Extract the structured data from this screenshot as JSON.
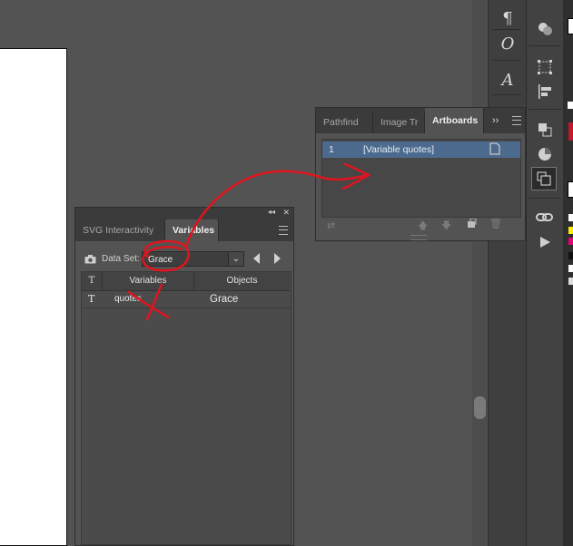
{
  "artboards_panel": {
    "tabs": [
      {
        "label": "Pathfind"
      },
      {
        "label": "Image Tr"
      },
      {
        "label": "Artboards"
      }
    ],
    "overflow_label": "››",
    "rows": [
      {
        "number": "1",
        "name": "[Variable quotes]"
      }
    ]
  },
  "variables_panel": {
    "tabs": [
      {
        "label": "SVG Interactivity"
      },
      {
        "label": "Variables"
      }
    ],
    "top_controls": {
      "collapse": "◂◂",
      "close": "✕"
    },
    "dataset_label": "Data Set:",
    "dataset_value": "Grace",
    "table_headers": {
      "type": "T",
      "variables": "Variables",
      "objects": "Objects"
    },
    "rows": [
      {
        "type": "T",
        "variable": "quotes",
        "object": "Grace"
      }
    ]
  },
  "tools": {
    "col1": [
      {
        "icon": "paragraph-icon",
        "glyph": "¶"
      },
      {
        "icon": "opentype-icon",
        "glyph": "O"
      },
      {
        "icon": "character-styles-icon",
        "glyph": "A"
      }
    ]
  },
  "colors": {
    "accent_selection": "#4c6a8d",
    "annotation": "#e0141e"
  }
}
